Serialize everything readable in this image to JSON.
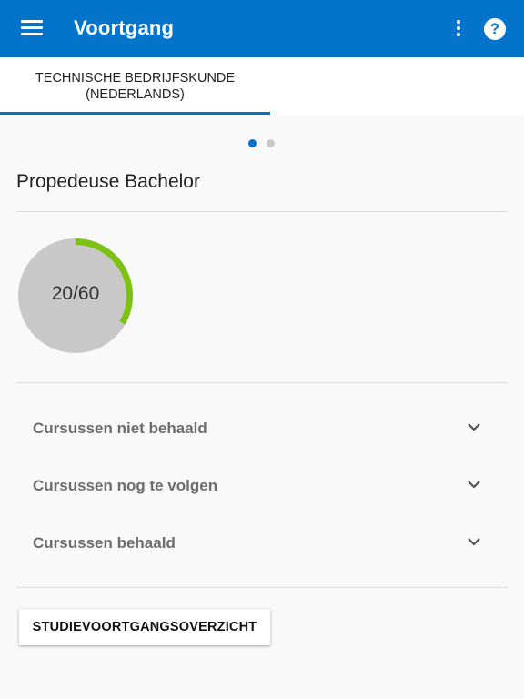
{
  "appbar": {
    "title": "Voortgang",
    "menu_icon": "hamburger-menu-icon",
    "more_icon": "more-vertical-icon",
    "help_icon": "help-circle-icon",
    "help_glyph": "?",
    "background": "#0374c9"
  },
  "tabs": [
    {
      "label": "TECHNISCHE BEDRIJFSKUNDE\n(NEDERLANDS)",
      "selected": true
    }
  ],
  "pager": {
    "count": 2,
    "active": 1
  },
  "program": {
    "title": "Propedeuse Bachelor",
    "progress": {
      "label": "20/60",
      "earned": 20,
      "total": 60,
      "fill_color": "#7cc113",
      "track_color": "#c8c8c8"
    }
  },
  "courses": [
    {
      "label": "Cursussen niet behaald"
    },
    {
      "label": "Cursussen nog te volgen"
    },
    {
      "label": "Cursussen behaald"
    }
  ],
  "overview_button": {
    "label": "STUDIEVOORTGANGSOVERZICHT"
  }
}
